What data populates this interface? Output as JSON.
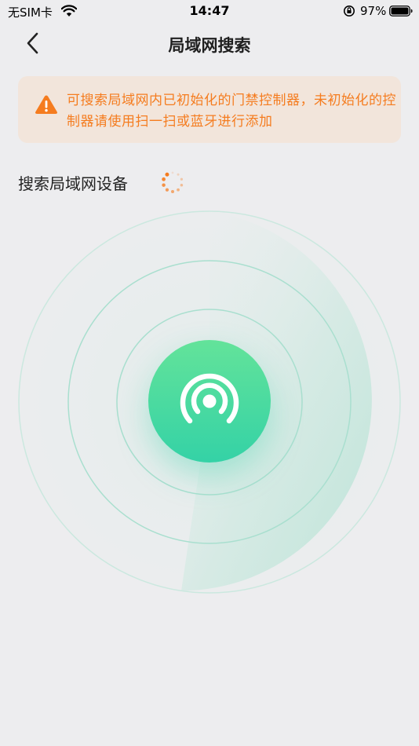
{
  "status_bar": {
    "carrier": "无SIM卡",
    "time": "14:47",
    "battery_percent": "97%",
    "battery_level": 0.97
  },
  "nav": {
    "title": "局域网搜索",
    "back_icon": "chevron-left-icon"
  },
  "warning": {
    "icon": "warning-triangle-icon",
    "text": "可搜索局域网内已初始化的门禁控制器，未初始化的控制器请使用扫一扫或蓝牙进行添加"
  },
  "search": {
    "heading": "搜索局域网设备",
    "loading_icon": "spinner-icon"
  },
  "radar": {
    "center_icon": "broadcast-icon"
  },
  "colors": {
    "background": "#ededef",
    "accent_green": "#34d2a6",
    "accent_green_light": "#63e39a",
    "warning_orange": "#f57c1f",
    "warning_bg": "#f2e5db"
  }
}
